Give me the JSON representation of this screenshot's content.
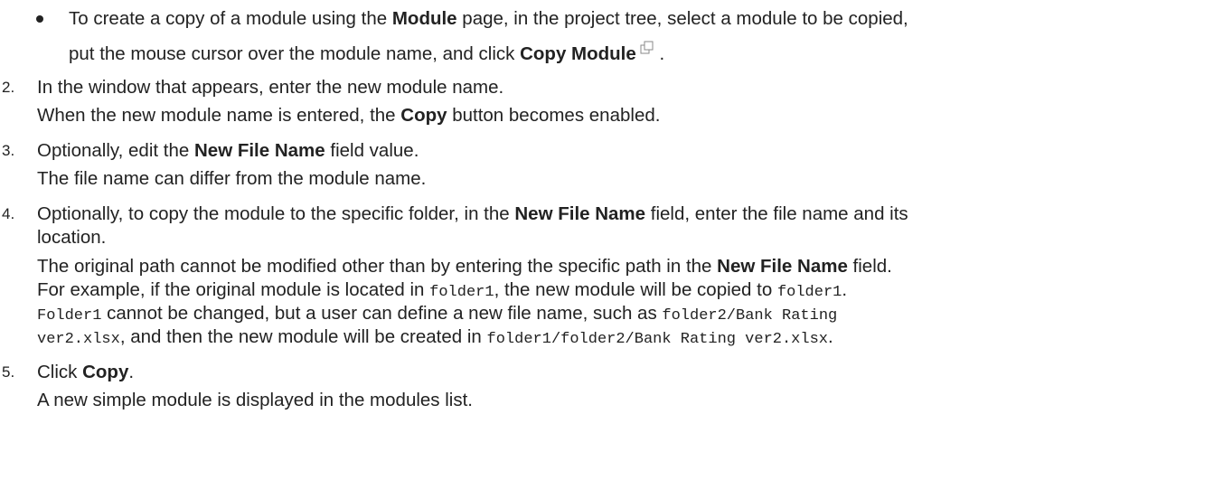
{
  "bullet": {
    "line1": {
      "a": "To create a copy of a module using the ",
      "b": "Module",
      "c": " page, in the project tree, select a module to be copied,"
    },
    "line2": {
      "a": "put the mouse cursor over the module name, and click ",
      "b": "Copy Module",
      "c": " ."
    },
    "icon": "copy-module-icon"
  },
  "steps": [
    {
      "number": "2.",
      "line1": "In the window that appears, enter the new module name.",
      "line2": {
        "a": "When the new module name is entered, the ",
        "b": "Copy",
        "c": " button becomes enabled."
      }
    },
    {
      "number": "3.",
      "line1": {
        "a": "Optionally, edit the ",
        "b": "New File Name",
        "c": " field value."
      },
      "line2": "The file name can differ from the module name."
    },
    {
      "number": "4.",
      "line1": {
        "a": "Optionally, to copy the module to the specific folder, in the ",
        "b": "New File Name",
        "c": " field, enter the file name and its"
      },
      "line1b": "location.",
      "line2": {
        "a": "The original path cannot be modified other than by entering the specific path in the ",
        "b": "New File Name",
        "c": " field."
      },
      "line3": {
        "a": "For example, if the original module is located in ",
        "code1": "folder1",
        "b": ", the new module will be copied to ",
        "code2": "folder1",
        "c": "."
      },
      "line4": {
        "code1": "Folder1",
        "a": " cannot be changed, but a user can define a new file name, such as ",
        "code2": "folder2/Bank Rating"
      },
      "line5": {
        "code1": "ver2.xlsx",
        "a": ", and then the new module will be created in ",
        "code2": "folder1/folder2/Bank Rating ver2.xlsx",
        "b": "."
      }
    },
    {
      "number": "5.",
      "line1": {
        "a": "Click ",
        "b": "Copy",
        "c": "."
      },
      "line2": "A new simple module is displayed in the modules list."
    }
  ]
}
